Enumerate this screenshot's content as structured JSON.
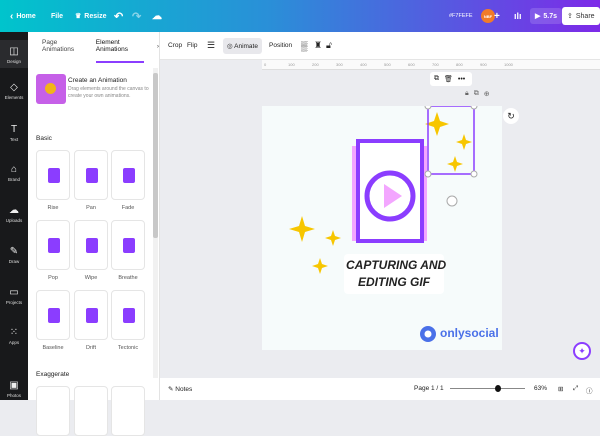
{
  "topbar": {
    "home": "Home",
    "file": "File",
    "resize": "Resize",
    "color_hex": "#F7FEFE",
    "avatar": "NBF",
    "duration": "5.7s",
    "share": "Share"
  },
  "nav": [
    {
      "label": "Design",
      "icon": "layout-icon"
    },
    {
      "label": "Elements",
      "icon": "shapes-icon"
    },
    {
      "label": "Text",
      "icon": "text-icon"
    },
    {
      "label": "Brand",
      "icon": "brand-icon"
    },
    {
      "label": "Uploads",
      "icon": "upload-icon"
    },
    {
      "label": "Draw",
      "icon": "pen-icon"
    },
    {
      "label": "Projects",
      "icon": "folder-icon"
    },
    {
      "label": "Apps",
      "icon": "apps-icon"
    },
    {
      "label": "Photos",
      "icon": "photo-icon"
    }
  ],
  "panel": {
    "tabs": [
      "Page Animations",
      "Element Animations"
    ],
    "create_title": "Create an Animation",
    "create_desc": "Drag elements around the canvas to create your own animations.",
    "basic_heading": "Basic",
    "basic": [
      "Rise",
      "Pan",
      "Fade",
      "Pop",
      "Wipe",
      "Breathe",
      "Baseline",
      "Drift",
      "Tectonic"
    ],
    "exaggerate_heading": "Exaggerate"
  },
  "toolbar": {
    "crop": "Crop",
    "flip": "Flip",
    "animate": "Animate",
    "position": "Position"
  },
  "ruler": [
    "0",
    "100",
    "200",
    "300",
    "400",
    "500",
    "600",
    "700",
    "800",
    "900",
    "1000"
  ],
  "canvas": {
    "title_line1": "CAPTURING AND",
    "title_line2": "EDITING GIF",
    "brand": "onlysocial"
  },
  "bottom": {
    "notes": "Notes",
    "page": "Page 1 / 1",
    "zoom": "63%",
    "zoom_fraction": 0.5
  },
  "colors": {
    "accent": "#8b3dff",
    "star": "#f7c600"
  }
}
